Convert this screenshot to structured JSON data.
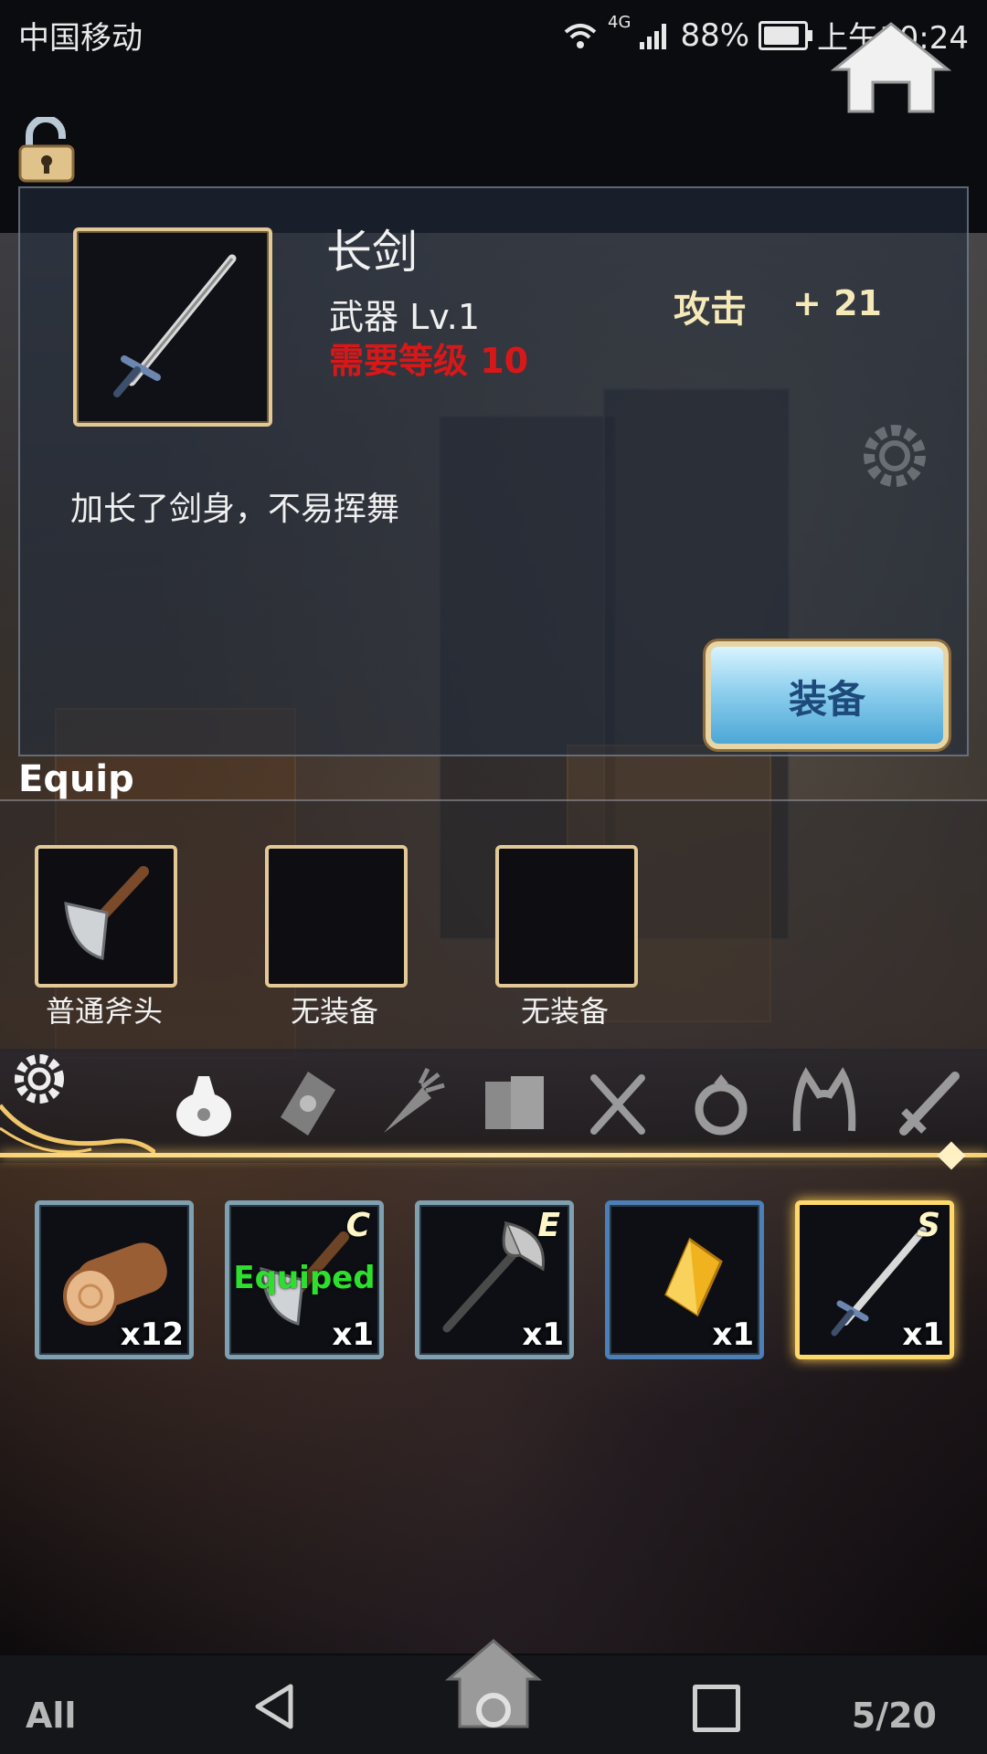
{
  "status_bar": {
    "carrier": "中国移动",
    "network": "4G",
    "battery": "88%",
    "time": "上午10:24"
  },
  "item_detail": {
    "name": "长剑",
    "type_level": "武器 Lv.1",
    "requirement": "需要等级 10",
    "stat_label": "攻击",
    "stat_value": "+ 21",
    "description": "加长了剑身，不易挥舞",
    "equip_button": "装备"
  },
  "equip_section": {
    "title": "Equip",
    "slots": [
      {
        "label": "普通斧头"
      },
      {
        "label": "无装备"
      },
      {
        "label": "无装备"
      }
    ]
  },
  "inventory": {
    "items": [
      {
        "count": "x12",
        "grade": "",
        "equipped": ""
      },
      {
        "count": "x1",
        "grade": "C",
        "equipped": "Equiped"
      },
      {
        "count": "x1",
        "grade": "E",
        "equipped": ""
      },
      {
        "count": "x1",
        "grade": "",
        "equipped": ""
      },
      {
        "count": "x1",
        "grade": "S",
        "equipped": ""
      }
    ]
  },
  "bottom": {
    "filter": "All",
    "page": "5/20"
  },
  "colors": {
    "gold": "#e2c894",
    "requirement_red": "#d81818",
    "equipped_green": "#2ee02e"
  }
}
